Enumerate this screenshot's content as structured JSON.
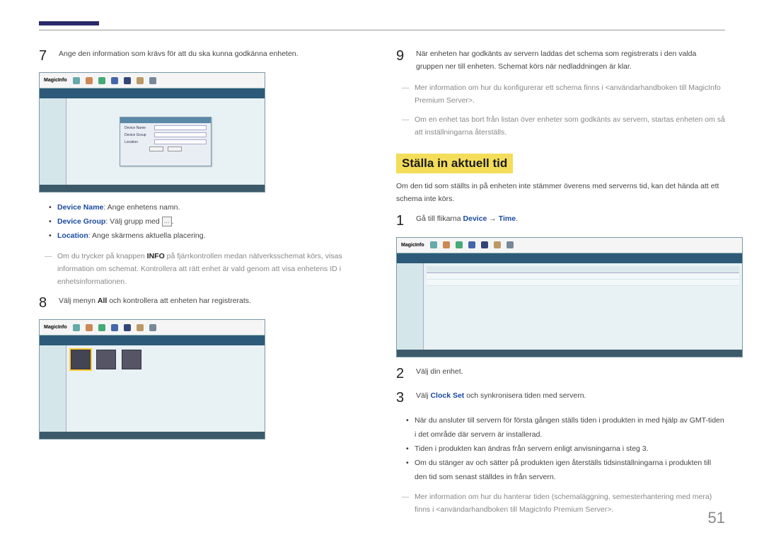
{
  "pageNumber": "51",
  "left": {
    "step7": {
      "num": "7",
      "text": "Ange den information som krävs för att du ska kunna godkänna enheten."
    },
    "bullets": {
      "b1_label": "Device Name",
      "b1_text": ": Ange enhetens namn.",
      "b2_label": "Device Group",
      "b2_text": ": Välj grupp med ",
      "b2_after": ".",
      "b3_label": "Location",
      "b3_text": ": Ange skärmens aktuella placering."
    },
    "note1_pre": "Om du trycker på knappen ",
    "note1_bold": "INFO",
    "note1_post": " på fjärrkontrollen medan nätverksschemat körs, visas information om schemat. Kontrollera att rätt enhet är vald genom att visa enhetens ID i enhetsinformationen.",
    "step8": {
      "num": "8",
      "pre": "Välj menyn ",
      "bold": "All",
      "post": " och kontrollera att enheten har registrerats."
    },
    "dialog": {
      "l1": "Device Name",
      "l2": "Device Group",
      "l3": "Location"
    },
    "logo": "MagicInfo"
  },
  "right": {
    "step9": {
      "num": "9",
      "text": "När enheten har godkänts av servern laddas det schema som registrerats i den valda gruppen ner till enheten. Schemat körs när nedladdningen är klar."
    },
    "note1": "Mer information om hur du konfigurerar ett schema finns i <användarhandboken till MagicInfo Premium Server>.",
    "note2": "Om en enhet tas bort från listan över enheter som godkänts av servern, startas enheten om så att inställningarna återställs.",
    "heading": "Ställa in aktuell tid",
    "intro": "Om den tid som ställts in på enheten inte stämmer överens med serverns tid, kan det hända att ett schema inte körs.",
    "step1": {
      "num": "1",
      "pre": "Gå till flikarna ",
      "b1": "Device",
      "arrow": " → ",
      "b2": "Time",
      "post": "."
    },
    "step2": {
      "num": "2",
      "text": "Välj din enhet."
    },
    "step3": {
      "num": "3",
      "pre": "Välj ",
      "bold": "Clock Set",
      "post": " och synkronisera tiden med servern."
    },
    "bullets": {
      "b1": "När du ansluter till servern för första gången ställs tiden i produkten in med hjälp av GMT-tiden i det område där servern är installerad.",
      "b2": "Tiden i produkten kan ändras från servern enligt anvisningarna i steg 3.",
      "b3": "Om du stänger av och sätter på produkten igen återställs tidsinställningarna i produkten till den tid som senast ställdes in från servern."
    },
    "note3": "Mer information om hur du hanterar tiden (schemaläggning, semesterhantering med mera) finns i <användarhandboken till MagicInfo Premium Server>.",
    "logo": "MagicInfo"
  }
}
